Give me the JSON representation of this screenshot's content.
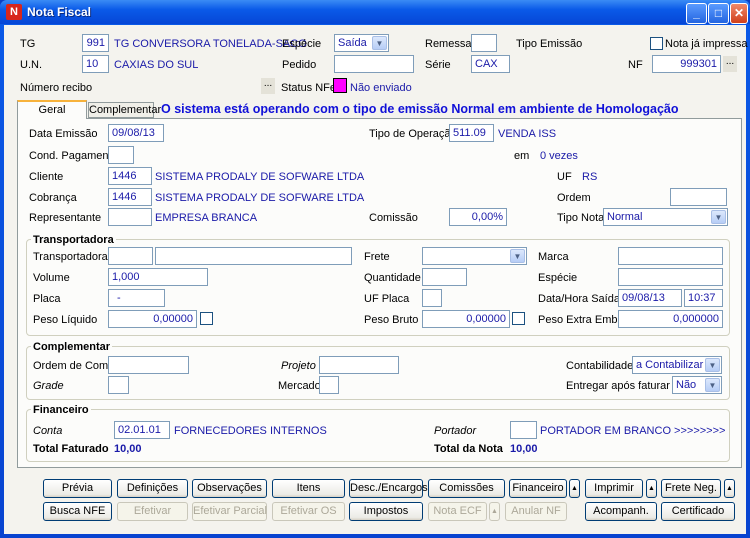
{
  "window": {
    "title": "Nota Fiscal",
    "minimize": "_",
    "maximize": "□",
    "close": "✕",
    "logo": "N"
  },
  "header": {
    "tg_label": "TG",
    "tg_code": "991",
    "tg_name": "TG CONVERSORA TONELADA-SACO",
    "especie_label": "Espécie",
    "especie_value": "Saída",
    "remessa_label": "Remessa",
    "remessa_value": "",
    "tipo_emissao_label": "Tipo Emissão",
    "nota_impressa_label": "Nota já impressa",
    "nota_impressa_checked": false,
    "un_label": "U.N.",
    "un_code": "10",
    "un_name": "CAXIAS DO SUL",
    "pedido_label": "Pedido",
    "pedido_value": "",
    "serie_label": "Série",
    "serie_value": "CAX",
    "nf_label": "NF",
    "nf_value": "999301",
    "ellipsis": "...",
    "recibo_label": "Número recibo",
    "status_label": "Status NFe",
    "status_value": "Não enviado",
    "status_color": "#ff00ff"
  },
  "tabs": [
    {
      "label": "Geral",
      "active": true
    },
    {
      "label": "Complementar",
      "active": false
    }
  ],
  "message": "O sistema está operando com o tipo de emissão Normal em ambiente de Homologação",
  "geral": {
    "data_emissao_label": "Data Emissão",
    "data_emissao": "09/08/13",
    "tipo_operacao_label": "Tipo de Operação",
    "tipo_operacao_code": "511.09",
    "tipo_operacao_name": "VENDA ISS",
    "cond_pag_label": "Cond. Pagamento",
    "cond_pag_value": "",
    "em_label": "em",
    "vezes": "0 vezes",
    "cliente_label": "Cliente",
    "cliente_code": "1446",
    "cliente_name": "SISTEMA PRODALY DE SOFWARE LTDA",
    "uf_label": "UF",
    "uf_value": "RS",
    "cobranca_label": "Cobrança",
    "cobranca_code": "1446",
    "cobranca_name": "SISTEMA PRODALY DE SOFWARE LTDA",
    "ordem_label": "Ordem",
    "ordem_value": "",
    "representante_label": "Representante",
    "representante_code": "",
    "representante_name": "EMPRESA BRANCA",
    "comissao_label": "Comissão",
    "comissao_value": "0,00%",
    "tipo_nota_label": "Tipo Nota",
    "tipo_nota_value": "Normal"
  },
  "transportadora": {
    "title": "Transportadora",
    "transportadora_label": "Transportadora",
    "frete_label": "Frete",
    "frete_value": "",
    "marca_label": "Marca",
    "volume_label": "Volume",
    "volume_value": "1,000",
    "quantidade_label": "Quantidade",
    "especie_label": "Espécie",
    "placa_label": "Placa",
    "placa_value": "-",
    "uf_placa_label": "UF Placa",
    "data_hora_label": "Data/Hora Saída",
    "data_saida": "09/08/13",
    "hora_saida": "10:37",
    "peso_liquido_label": "Peso Líquido",
    "peso_liquido": "0,00000",
    "peso_bruto_label": "Peso Bruto",
    "peso_bruto": "0,00000",
    "peso_extra_label": "Peso Extra Emb.",
    "peso_extra": "0,000000"
  },
  "complementar": {
    "title": "Complementar",
    "ordem_compra_label": "Ordem de Compra",
    "projeto_label": "Projeto",
    "contabilidade_label": "Contabilidade",
    "contabilidade_value": "a Contabilizar",
    "grade_label": "Grade",
    "mercado_label": "Mercado",
    "entregar_label": "Entregar após faturar",
    "entregar_value": "Não"
  },
  "financeiro": {
    "title": "Financeiro",
    "conta_label": "Conta",
    "conta_code": "02.01.01",
    "conta_name": "FORNECEDORES INTERNOS",
    "portador_label": "Portador",
    "portador_name": "PORTADOR EM BRANCO >>>>>>>>",
    "total_faturado_label": "Total Faturado",
    "total_faturado": "10,00",
    "total_nota_label": "Total da Nota",
    "total_nota": "10,00"
  },
  "buttons": {
    "previa": "Prévia",
    "definicoes": "Definições",
    "observacoes": "Observações",
    "itens": "Itens",
    "desc_encargos": "Desc./Encargos",
    "comissoes": "Comissões",
    "financeiro": "Financeiro",
    "imprimir": "Imprimir",
    "frete_neg": "Frete Neg.",
    "busca_nfe": "Busca NFE",
    "efetivar": "Efetivar",
    "efetivar_parcial": "Efetivar Parcial",
    "efetivar_os": "Efetivar OS",
    "impostos": "Impostos",
    "nota_ecf": "Nota ECF",
    "anular_nf": "Anular NF",
    "acompanh": "Acompanh.",
    "certificado": "Certificado",
    "arrow": "▲"
  }
}
